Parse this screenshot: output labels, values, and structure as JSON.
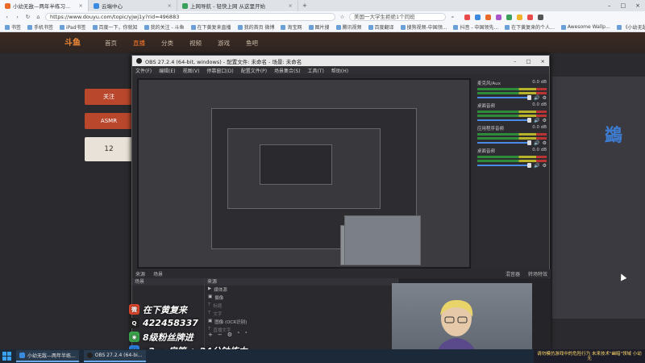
{
  "browser": {
    "tabs": [
      {
        "title": "小幼无敌—两年半练习...",
        "color": "#e86b2a",
        "active": true
      },
      {
        "title": "云端中心",
        "color": "#3a8ae0",
        "active": false
      },
      {
        "title": "上网导航 - 轻快上网 从这里开始",
        "color": "#3aa05a",
        "active": false
      }
    ],
    "url": "https://www.douyu.com/topic/yjwj1y?rid=496883",
    "search_text": "美国一大学生拒绝1个同班",
    "bookmarks": [
      "书签",
      "手机书签",
      "iPad书签",
      "百度一下，你就知",
      "我的关注 - 斗鱼",
      "在下黄复来直播",
      "我的首页 微博",
      "淘宝网",
      "图片搜",
      "腾讯视频",
      "百度翻译",
      "搜狗视频-中国领...",
      "抖音 - 中国领先...",
      "在下黄复来的个人...",
      "Awesome Wallp...",
      "《小幼无敌》复",
      "小幼无敌"
    ]
  },
  "site": {
    "logo": "斗鱼",
    "nav": [
      "首页",
      "直播",
      "分类",
      "视频",
      "游戏",
      "鱼吧"
    ],
    "active_nav": 1,
    "side_buttons": [
      "关注",
      "ASMR",
      "12"
    ],
    "brand_text": "鷁"
  },
  "obs": {
    "title": "OBS 27.2.4 (64-bit, windows) - 配置文件: 未命名 - 场景: 未命名",
    "menu": [
      "文件(F)",
      "编辑(E)",
      "视图(V)",
      "停靠窗口(D)",
      "配置文件(P)",
      "场景集合(S)",
      "工具(T)",
      "帮助(H)"
    ],
    "mixer": [
      {
        "name": "麦克风/Aux",
        "db": "0.0 dB"
      },
      {
        "name": "桌面音频",
        "db": "0.0 dB"
      },
      {
        "name": "应用程序音频",
        "db": "0.0 dB"
      },
      {
        "name": "桌面音频",
        "db": "0.0 dB"
      }
    ],
    "dock_tabs": [
      "来源",
      "场景",
      "混音器",
      "转场特效"
    ],
    "panels": {
      "scenes": "场景",
      "sources": "来源"
    },
    "sources": [
      "媒体源",
      "摄像",
      "标题",
      "文字",
      "图像 (OCR识别)",
      "直播文字"
    ]
  },
  "overlay": {
    "lines": [
      {
        "text": "在下黄复来",
        "icon": "weibo-icon",
        "color": "#e0482a"
      },
      {
        "text": "422458337",
        "icon": "qq-icon",
        "color": "#222222"
      },
      {
        "text": "8级粉丝牌进",
        "icon": "wechat-icon",
        "color": "#3aa24a"
      },
      {
        "text": "x2 = 房管 + 24分钟练力",
        "icon": "bubble-icon",
        "color": "#2a7ad8"
      }
    ]
  },
  "banner": {
    "text": "请勿模仿游戏中的危险行为 未来技术\"幽暗\"领域 小幼无"
  },
  "taskbar": {
    "items": [
      "小幼无敌—两年半练...",
      "OBS 27.2.4 (64-bi..."
    ]
  }
}
